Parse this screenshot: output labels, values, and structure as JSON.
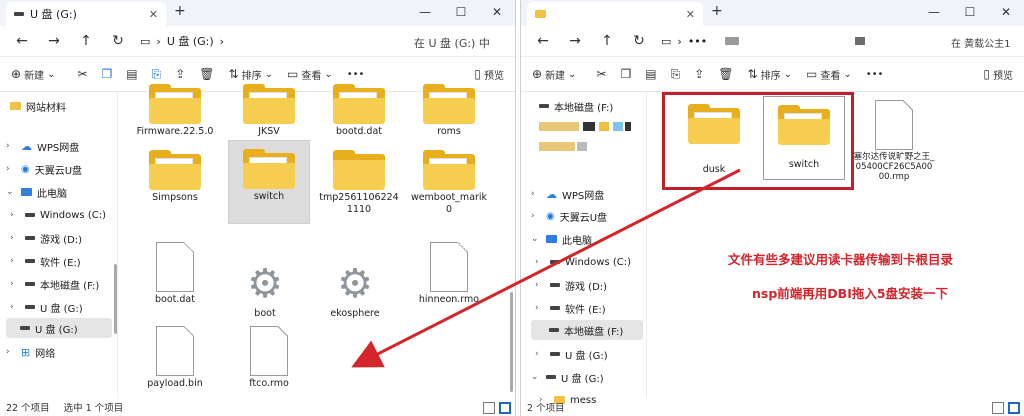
{
  "left": {
    "tab_title": "U 盘 (G:)",
    "breadcrumb": [
      "U 盘 (G:)"
    ],
    "search_placeholder": "在 U 盘 (G:) 中",
    "toolbar": {
      "new": "新建",
      "sort": "排序",
      "view": "查看",
      "more": "•••",
      "details": "预览"
    },
    "sidebar": [
      {
        "label": "网站材料",
        "icon": "folder-icon",
        "chev": ""
      },
      {
        "label": "WPS网盘",
        "icon": "cloud-icon",
        "chev": "›"
      },
      {
        "label": "天翼云U盘",
        "icon": "tianyi-cloud-icon",
        "chev": "›"
      },
      {
        "label": "此电脑",
        "icon": "pc-icon",
        "chev": "⌄"
      },
      {
        "label": "Windows (C:)",
        "icon": "drive-icon",
        "chev": "›"
      },
      {
        "label": "游戏 (D:)",
        "icon": "drive-icon",
        "chev": "›"
      },
      {
        "label": "软件 (E:)",
        "icon": "drive-icon",
        "chev": "›"
      },
      {
        "label": "本地磁盘 (F:)",
        "icon": "drive-icon",
        "chev": "›"
      },
      {
        "label": "U 盘 (G:)",
        "icon": "drive-icon",
        "chev": "›"
      },
      {
        "label": "U 盘 (G:)",
        "icon": "drive-icon",
        "chev": "",
        "selected": true
      },
      {
        "label": "网络",
        "icon": "network-icon",
        "chev": "›"
      }
    ],
    "files": [
      {
        "name": "Firmware.22.5.0",
        "type": "folder"
      },
      {
        "name": "JKSV",
        "type": "folder"
      },
      {
        "name": "bootd.dat",
        "type": "folder"
      },
      {
        "name": "roms",
        "type": "folder"
      },
      {
        "name": "Simpsons",
        "type": "folder"
      },
      {
        "name": "switch",
        "type": "folder",
        "selected": true
      },
      {
        "name": "tmp25611062241110",
        "type": "folder-plain"
      },
      {
        "name": "wemboot_marik0",
        "type": "folder"
      },
      {
        "name": "boot.dat",
        "type": "doc"
      },
      {
        "name": "boot",
        "type": "gear"
      },
      {
        "name": "ekosphere",
        "type": "gear"
      },
      {
        "name": "hinneon.rmo",
        "type": "doc"
      },
      {
        "name": "payload.bin",
        "type": "doc"
      },
      {
        "name": "ftco.rmo",
        "type": "doc"
      }
    ],
    "status": {
      "count": "22 个项目",
      "selected": "选中 1 个项目"
    }
  },
  "right": {
    "breadcrumb_more": "•••",
    "search_placeholder": "在 黄载公主1",
    "toolbar": {
      "new": "新建",
      "sort": "排序",
      "view": "查看",
      "more": "•••",
      "details": "预览"
    },
    "sidebar": [
      {
        "label": "本地磁盘 (F:)",
        "icon": "drive-icon",
        "chev": ""
      },
      {
        "label": "WPS网盘",
        "icon": "cloud-icon",
        "chev": "›"
      },
      {
        "label": "天翼云U盘",
        "icon": "tianyi-cloud-icon",
        "chev": "›"
      },
      {
        "label": "此电脑",
        "icon": "pc-icon",
        "chev": "⌄"
      },
      {
        "label": "Windows (C:)",
        "icon": "drive-icon",
        "chev": "›"
      },
      {
        "label": "游戏 (D:)",
        "icon": "drive-icon",
        "chev": "›"
      },
      {
        "label": "软件 (E:)",
        "icon": "drive-icon",
        "chev": "›"
      },
      {
        "label": "本地磁盘 (F:)",
        "icon": "drive-icon",
        "chev": "",
        "selected": true
      },
      {
        "label": "U 盘 (G:)",
        "icon": "drive-icon",
        "chev": "›"
      },
      {
        "label": "U 盘 (G:)",
        "icon": "drive-icon",
        "chev": "⌄"
      },
      {
        "label": "mess",
        "icon": "folder-icon",
        "chev": "›"
      }
    ],
    "files": [
      {
        "name": "dusk",
        "type": "folder"
      },
      {
        "name": "switch",
        "type": "folder"
      },
      {
        "name": "塞尔达传说旷野之王_05400CF26C5A0000.rmp",
        "type": "doc"
      }
    ],
    "status": {
      "count": "2 个项目"
    }
  },
  "annotations": {
    "line1": "文件有些多建议用读卡器传输到卡根目录",
    "line2": "nsp前端再用DBI拖入5盘安装一下"
  },
  "colors": {
    "annotation": "#d4242c",
    "box": "#c0202a",
    "folder": "#f6cd4e"
  }
}
